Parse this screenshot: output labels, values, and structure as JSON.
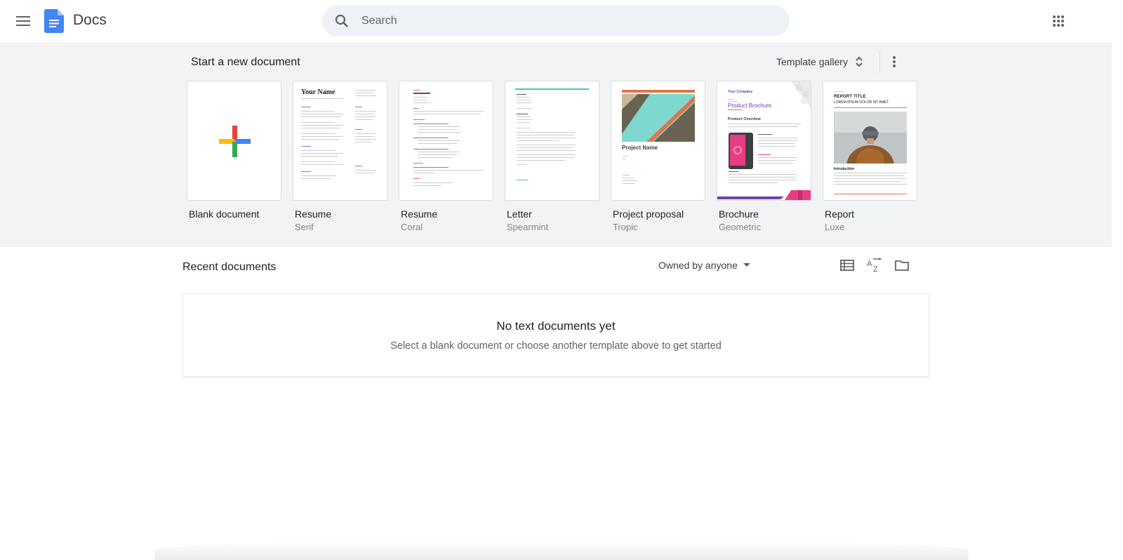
{
  "app": {
    "title": "Docs"
  },
  "search": {
    "placeholder": "Search"
  },
  "templates_section": {
    "title": "Start a new document",
    "gallery_label": "Template gallery",
    "items": [
      {
        "name": "Blank document",
        "sub": ""
      },
      {
        "name": "Resume",
        "sub": "Serif"
      },
      {
        "name": "Resume",
        "sub": "Coral"
      },
      {
        "name": "Letter",
        "sub": "Spearmint"
      },
      {
        "name": "Project proposal",
        "sub": "Tropic"
      },
      {
        "name": "Brochure",
        "sub": "Geometric"
      },
      {
        "name": "Report",
        "sub": "Luxe"
      }
    ],
    "thumb_text": {
      "resume_serif_heading": "Your Name",
      "tropic_heading": "Project Name",
      "brochure_company": "Your Company",
      "brochure_heading": "Product Brochure",
      "brochure_overview": "Product Overview",
      "report_title": "REPORT TITLE",
      "report_subtitle": "LOREM IPSUM DOLOR SIT AMET",
      "report_intro": "Introduction"
    }
  },
  "recent": {
    "title": "Recent documents",
    "owner_filter": "Owned by anyone",
    "empty_title": "No text documents yet",
    "empty_subtitle": "Select a blank document or choose another template above to get started"
  },
  "colors": {
    "docs_blue": "#4285f4",
    "plus_red": "#ea4335",
    "plus_yellow": "#fbbc04",
    "plus_green": "#34a853",
    "plus_blue": "#4285f4",
    "band_bg": "#f1f3f4"
  },
  "icons": [
    "menu-icon",
    "docs-logo",
    "search-icon",
    "apps-grid-icon",
    "sort-arrows-icon",
    "more-vert-icon",
    "dropdown-arrow-icon",
    "list-view-icon",
    "sort-az-icon",
    "folder-icon"
  ]
}
